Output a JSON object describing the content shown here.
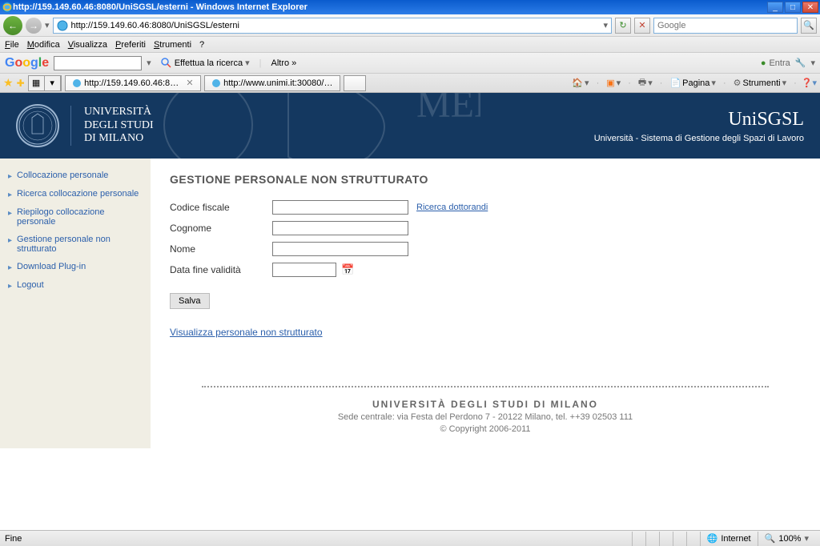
{
  "window": {
    "title": "http://159.149.60.46:8080/UniSGSL/esterni - Windows Internet Explorer"
  },
  "addressbar": {
    "url": "http://159.149.60.46:8080/UniSGSL/esterni",
    "search_placeholder": "Google"
  },
  "menus": {
    "file": "File",
    "modifica": "Modifica",
    "visualizza": "Visualizza",
    "preferiti": "Preferiti",
    "strumenti": "Strumenti",
    "help": "?"
  },
  "google_toolbar": {
    "search_label": "Effettua la ricerca",
    "altro": "Altro »",
    "entra": "Entra"
  },
  "tabs": {
    "tab1": "http://159.149.60.46:808...",
    "tab2": "http://www.unimi.it:30080/U..."
  },
  "ie_tools": {
    "pagina": "Pagina",
    "strumenti": "Strumenti"
  },
  "banner": {
    "uni1": "UNIVERSITÀ",
    "uni2": "DEGLI STUDI",
    "uni3": "DI MILANO",
    "appname": "UniSGSL",
    "subtitle": "Università - Sistema di Gestione degli Spazi di Lavoro"
  },
  "sidebar": {
    "items": [
      "Collocazione personale",
      "Ricerca collocazione personale",
      "Riepilogo collocazione personale",
      "Gestione personale non strutturato",
      "Download Plug-in",
      "Logout"
    ]
  },
  "form": {
    "heading": "GESTIONE PERSONALE NON STRUTTURATO",
    "codice_fiscale": "Codice fiscale",
    "ricerca_dottorandi": "Ricerca dottorandi",
    "cognome": "Cognome",
    "nome": "Nome",
    "data_fine": "Data fine validità",
    "salva": "Salva",
    "visualizza": "Visualizza personale non strutturato"
  },
  "footer": {
    "line1": "UNIVERSITÀ DEGLI STUDI DI MILANO",
    "line2": "Sede centrale: via Festa del Perdono 7 - 20122 Milano, tel. ++39 02503 111",
    "line3": "© Copyright 2006-2011"
  },
  "statusbar": {
    "left": "Fine",
    "zone": "Internet",
    "zoom": "100%"
  }
}
